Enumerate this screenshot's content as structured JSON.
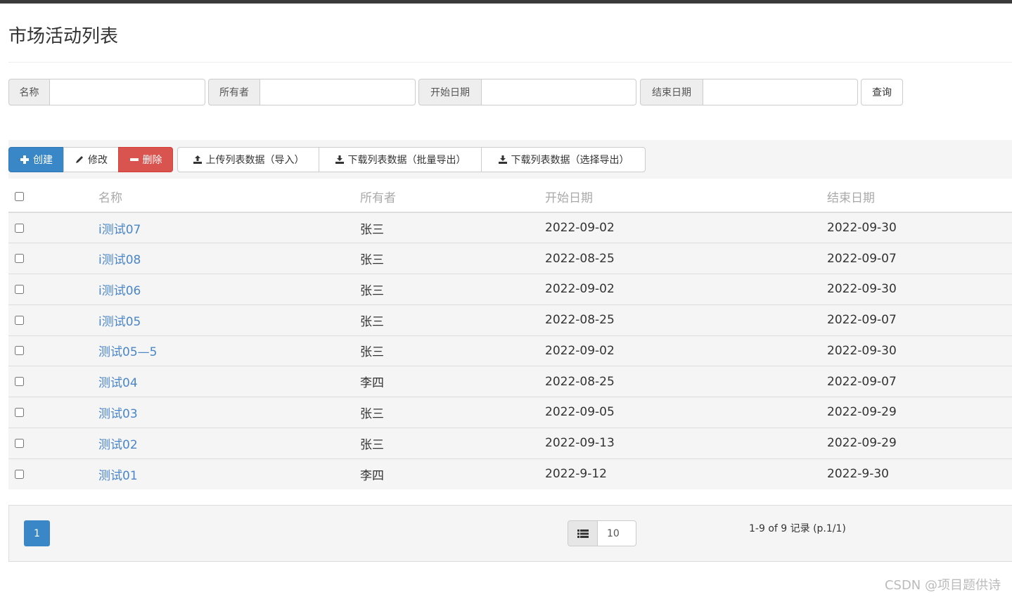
{
  "page": {
    "title": "市场活动列表"
  },
  "search": {
    "name_label": "名称",
    "owner_label": "所有者",
    "start_label": "开始日期",
    "end_label": "结束日期",
    "query_button": "查询"
  },
  "toolbar": {
    "create": "创建",
    "edit": "修改",
    "delete": "删除",
    "upload": "上传列表数据（导入）",
    "download_batch": "下载列表数据（批量导出）",
    "download_select": "下载列表数据（选择导出）"
  },
  "table": {
    "columns": [
      "名称",
      "所有者",
      "开始日期",
      "结束日期"
    ],
    "rows": [
      {
        "name": "i测试07",
        "owner": "张三",
        "start": "2022-09-02",
        "end": "2022-09-30"
      },
      {
        "name": "i测试08",
        "owner": "张三",
        "start": "2022-08-25",
        "end": "2022-09-07"
      },
      {
        "name": "i测试06",
        "owner": "张三",
        "start": "2022-09-02",
        "end": "2022-09-30"
      },
      {
        "name": "i测试05",
        "owner": "张三",
        "start": "2022-08-25",
        "end": "2022-09-07"
      },
      {
        "name": "测试05—5",
        "owner": "张三",
        "start": "2022-09-02",
        "end": "2022-09-30"
      },
      {
        "name": "测试04",
        "owner": "李四",
        "start": "2022-08-25",
        "end": "2022-09-07"
      },
      {
        "name": "测试03",
        "owner": "张三",
        "start": "2022-09-05",
        "end": "2022-09-29"
      },
      {
        "name": "测试02",
        "owner": "张三",
        "start": "2022-09-13",
        "end": "2022-09-29"
      },
      {
        "name": "测试01",
        "owner": "李四",
        "start": "2022-9-12",
        "end": "2022-9-30"
      }
    ]
  },
  "pagination": {
    "current_page": "1",
    "page_size": "10",
    "record_info": "1-9 of 9 记录 (p.1/1)"
  },
  "watermark": "CSDN @项目题供诗",
  "colors": {
    "primary": "#3a87c8",
    "danger": "#d9534f",
    "link": "#4a86c8"
  }
}
